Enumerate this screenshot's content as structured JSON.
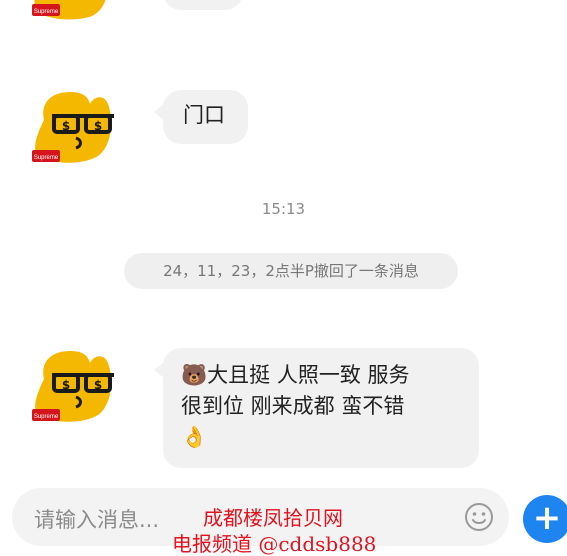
{
  "messages": [
    {
      "text": ""
    },
    {
      "text": "门口"
    },
    {
      "line1": "🐻大且挺 人照一致 服务",
      "line2": "很到位 刚来成都 蛮不错",
      "line3": "👌"
    }
  ],
  "avatar_badge": "Supreme",
  "time_label": "15:13",
  "recall_notice": "24，11，23，2点半P撤回了一条消息",
  "input": {
    "placeholder": "请输入消息..."
  },
  "plus_label": "+",
  "watermark": {
    "line1": "成都楼凤拾贝网",
    "line2": "电报频道 @cddsb888"
  },
  "colors": {
    "accent": "#1e84f0",
    "bubble": "#f1f1f1",
    "watermark": "#e0131e",
    "avatar": "#f5b800"
  },
  "icons": {
    "avatar": "cartoon-avatar-icon",
    "emoji": "smiley-icon",
    "plus": "plus-icon"
  }
}
